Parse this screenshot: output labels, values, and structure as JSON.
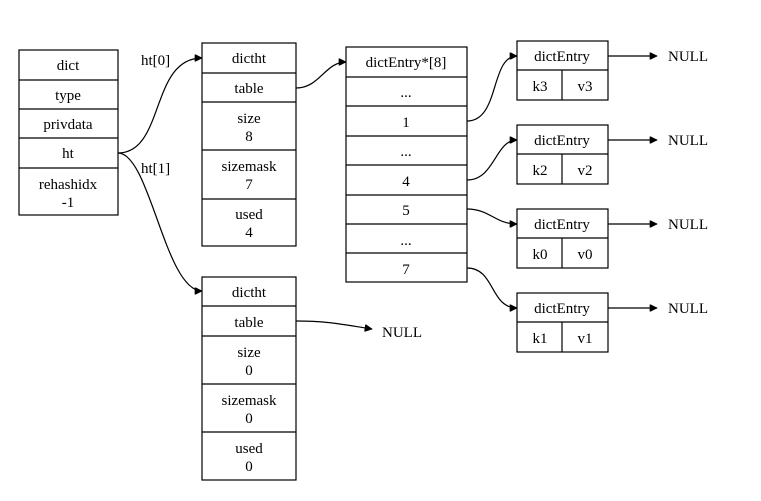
{
  "dict": {
    "title": "dict",
    "fields": [
      "type",
      "privdata",
      "ht"
    ],
    "rehashidx_label": "rehashidx",
    "rehashidx_value": "-1"
  },
  "edge_labels": {
    "ht0": "ht[0]",
    "ht1": "ht[1]"
  },
  "ht0": {
    "title": "dictht",
    "table": "table",
    "size_label": "size",
    "size": "8",
    "sizemask_label": "sizemask",
    "sizemask": "7",
    "used_label": "used",
    "used": "4"
  },
  "ht1": {
    "title": "dictht",
    "table": "table",
    "size_label": "size",
    "size": "0",
    "sizemask_label": "sizemask",
    "sizemask": "0",
    "used_label": "used",
    "used": "0",
    "table_target": "NULL"
  },
  "array": {
    "title": "dictEntry*[8]",
    "cells": [
      "...",
      "1",
      "...",
      "4",
      "5",
      "...",
      "7"
    ]
  },
  "entries": [
    {
      "title": "dictEntry",
      "key": "k3",
      "value": "v3",
      "next": "NULL"
    },
    {
      "title": "dictEntry",
      "key": "k2",
      "value": "v2",
      "next": "NULL"
    },
    {
      "title": "dictEntry",
      "key": "k0",
      "value": "v0",
      "next": "NULL"
    },
    {
      "title": "dictEntry",
      "key": "k1",
      "value": "v1",
      "next": "NULL"
    }
  ]
}
